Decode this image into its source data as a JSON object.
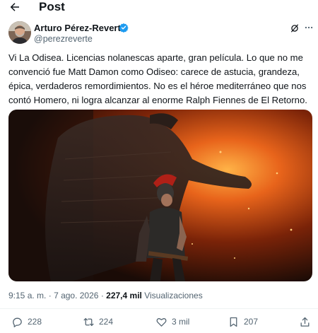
{
  "header": {
    "title": "Post"
  },
  "author": {
    "name": "Arturo Pérez-Reverte",
    "handle": "@perezreverte"
  },
  "post": {
    "text": "Vi La Odisea. Licencias nolanescas aparte, gran película. Lo que no me convenció fue Matt Damon como Odiseo: carece de astucia, grandeza, épica, verdaderos remordimientos. No es el héroe mediterráneo que nos contó Homero, ni logra alcanzar al enorme Ralph Fiennes de El Retorno.",
    "time": "9:15 a. m.",
    "separator": "·",
    "date": "7 ago. 2026",
    "views_count": "227,4 mil",
    "views_label": "Visualizaciones"
  },
  "actions": {
    "replies": "228",
    "reposts": "224",
    "likes": "3 mil",
    "bookmarks": "207"
  },
  "colors": {
    "text": "#0f1419",
    "secondary": "#536471",
    "verified": "#1d9bf0",
    "divider": "#eff3f4"
  },
  "icons": [
    "back-arrow-icon",
    "verified-badge-icon",
    "grok-icon",
    "more-icon",
    "reply-icon",
    "repost-icon",
    "like-icon",
    "bookmark-icon",
    "share-icon"
  ]
}
